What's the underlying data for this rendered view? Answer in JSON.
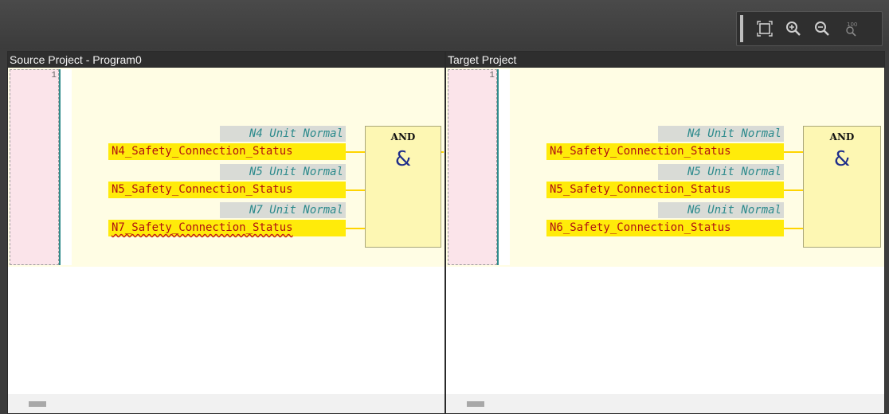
{
  "toolbar": {
    "buttons": [
      {
        "name": "fit-to-window-icon",
        "label": "Fit"
      },
      {
        "name": "zoom-in-icon",
        "label": "Zoom In"
      },
      {
        "name": "zoom-out-icon",
        "label": "Zoom Out"
      },
      {
        "name": "zoom-100-icon",
        "label": "100%"
      }
    ]
  },
  "left": {
    "title": "Source Project - Program0",
    "line_number": "1",
    "function_block": {
      "name": "AND",
      "symbol": "&"
    },
    "inputs": [
      {
        "comment": "N4 Unit Normal",
        "variable": "N4_Safety_Connection_Status"
      },
      {
        "comment": "N5 Unit Normal",
        "variable": "N5_Safety_Connection_Status"
      },
      {
        "comment": "N7 Unit Normal",
        "variable": "N7_Safety_Connection_Status"
      }
    ]
  },
  "right": {
    "title": "Target Project",
    "line_number": "1",
    "function_block": {
      "name": "AND",
      "symbol": "&"
    },
    "inputs": [
      {
        "comment": "N4 Unit Normal",
        "variable": "N4_Safety_Connection_Status"
      },
      {
        "comment": "N5 Unit Normal",
        "variable": "N5_Safety_Connection_Status"
      },
      {
        "comment": "N6 Unit Normal",
        "variable": "N6_Safety_Connection_Status"
      }
    ]
  },
  "colors": {
    "variable_highlight": "#ffeb0a",
    "variable_text": "#b01212",
    "comment_text": "#2c8a8c",
    "canvas_background": "#fffde4",
    "block_fill": "#fdf7b3"
  }
}
